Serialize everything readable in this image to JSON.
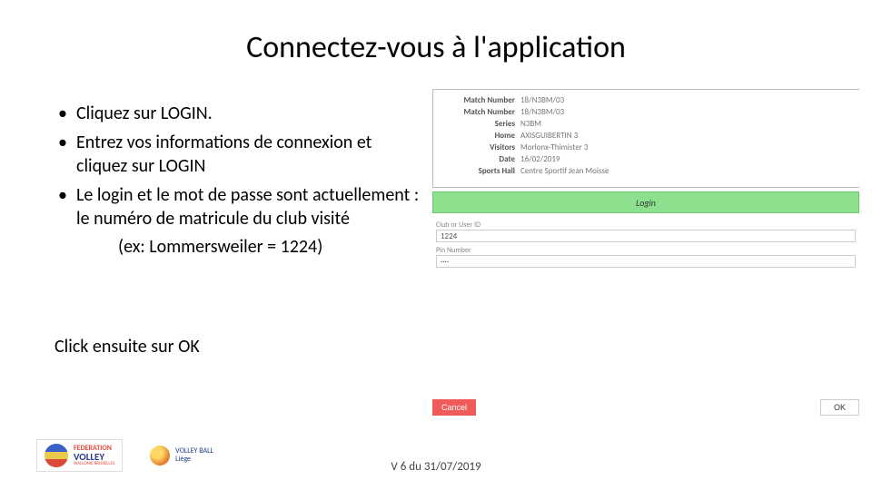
{
  "title": "Connectez-vous à l'application",
  "bullets": {
    "b1": "Cliquez sur LOGIN.",
    "b2": "Entrez vos informations de connexion et cliquez sur LOGIN",
    "b3": "Le login et le mot de passe sont actuellement : le numéro de matricule du club visité",
    "example": "(ex: Lommersweiler = 1224)"
  },
  "click_ok": "Click ensuite sur OK",
  "match": {
    "row1": {
      "lbl": "Match Number",
      "val": "18/N3BM/03"
    },
    "row2": {
      "lbl": "Match Number",
      "val": "18/N3BM/03"
    },
    "row3": {
      "lbl": "Series",
      "val": "N3BM"
    },
    "row4": {
      "lbl": "Home",
      "val": "AXISGUIBERTIN 3"
    },
    "row5": {
      "lbl": "Visitors",
      "val": "Morlonx-Thimister 3"
    },
    "row6": {
      "lbl": "Date",
      "val": "16/02/2019"
    },
    "row7": {
      "lbl": "Sports Hall",
      "val": "Centre Sportif Jean Moisse"
    }
  },
  "login": {
    "bar": "Login",
    "field1_lbl": "Club or User ID",
    "field1_val": "1224",
    "field2_lbl": "Pin Number",
    "field2_val": "····"
  },
  "buttons": {
    "cancel": "Cancel",
    "ok": "OK"
  },
  "logos": {
    "fed": "FEDERATION",
    "vol": "VOLLEY",
    "wal": "WALLONIE BRUXELLES",
    "vb": "VOLLEY BALL",
    "liege": "Liège"
  },
  "footer": "V 6 du 31/07/2019"
}
